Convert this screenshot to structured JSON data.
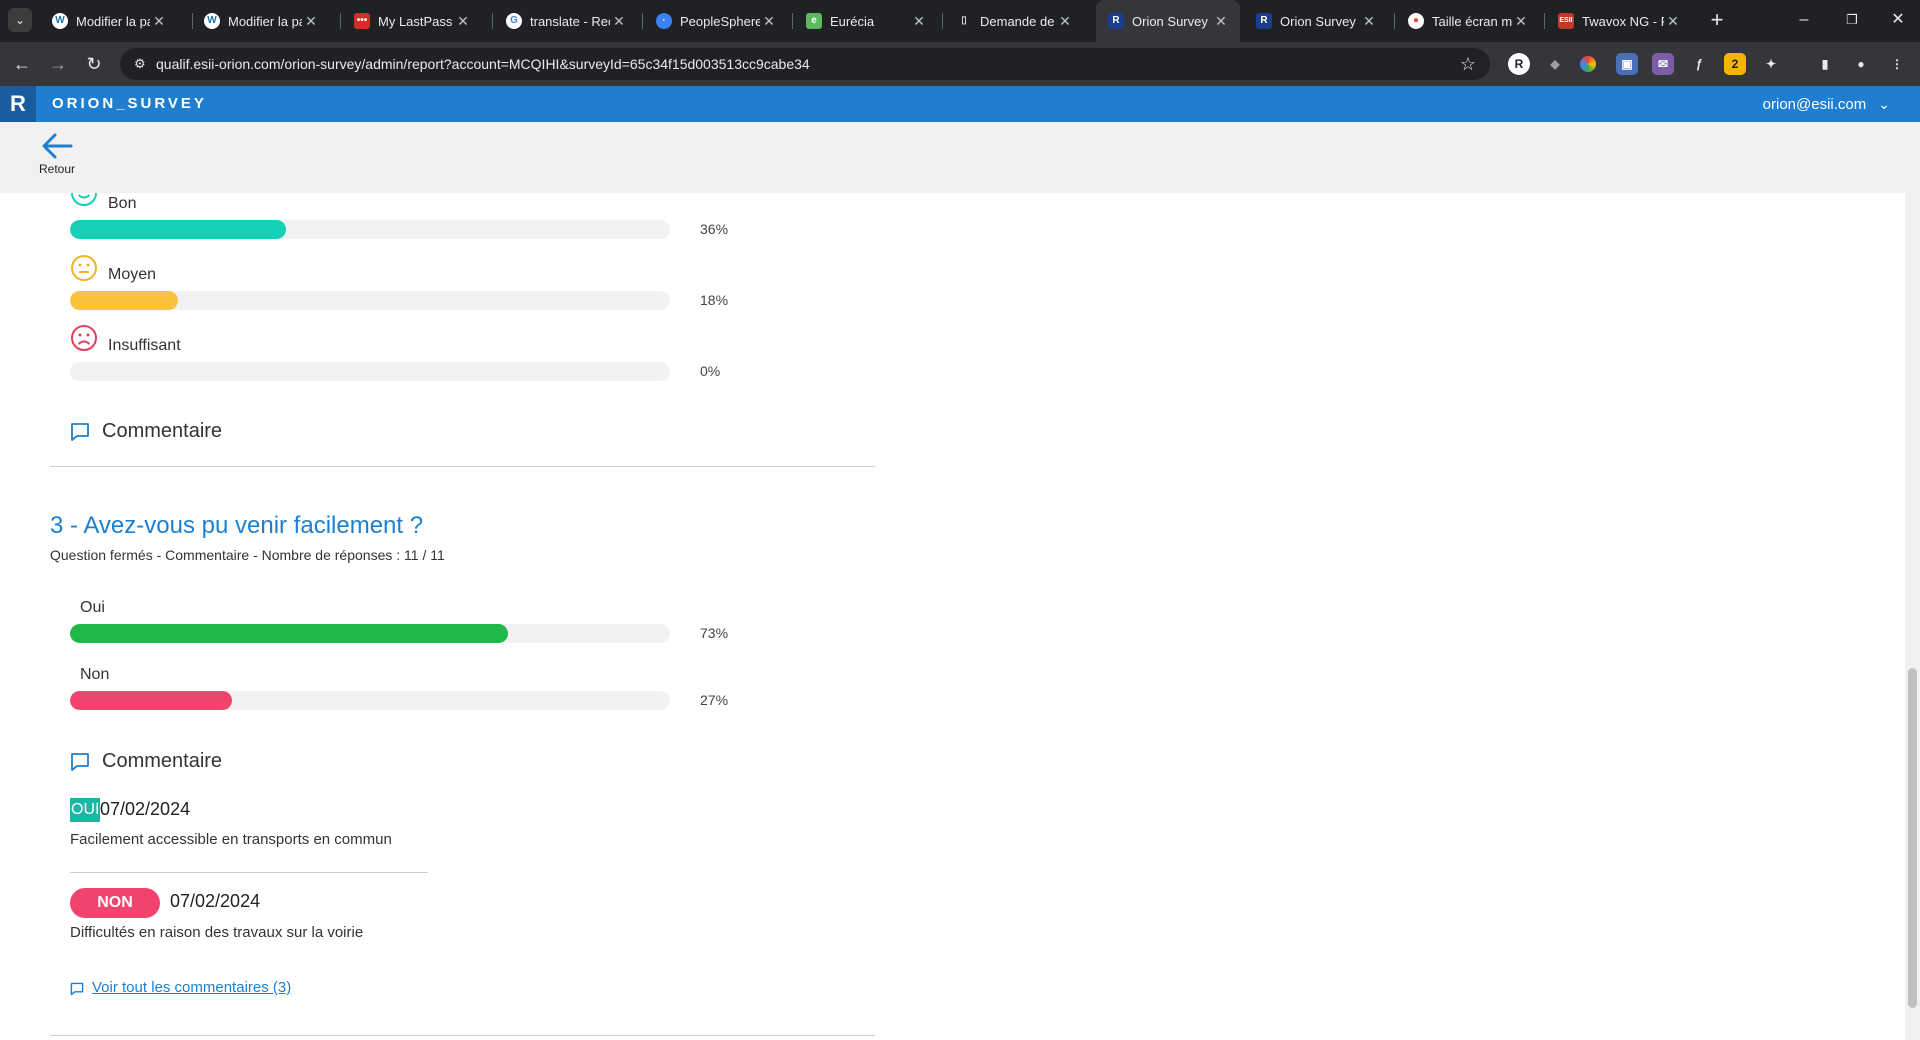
{
  "browser": {
    "tab_list_icon": "chevron-down-icon",
    "tabs": [
      {
        "title": "Modifier la page",
        "favicon": "wordpress-icon",
        "color": "#ffffff",
        "active": false
      },
      {
        "title": "Modifier la page",
        "favicon": "wordpress-icon",
        "color": "#ffffff",
        "active": false
      },
      {
        "title": "My LastPass Vault",
        "favicon": "lastpass-icon",
        "color": "#d32d27",
        "active": false
      },
      {
        "title": "translate - Recherche",
        "favicon": "google-icon",
        "color": "#ffffff",
        "active": false
      },
      {
        "title": "PeopleSpheres",
        "favicon": "peoplespheres-icon",
        "color": "#3b82f6",
        "active": false
      },
      {
        "title": "Eurécia",
        "favicon": "eurecia-icon",
        "color": "#5cb85c",
        "active": false
      },
      {
        "title": "Demande de congé",
        "favicon": "document-icon",
        "color": "#333333",
        "active": false
      },
      {
        "title": "Orion Survey",
        "favicon": "orion-icon",
        "color": "#1a3d8f",
        "active": true
      },
      {
        "title": "Orion Survey",
        "favicon": "orion-icon",
        "color": "#1a3d8f",
        "active": false
      },
      {
        "title": "Taille écran moyen",
        "favicon": "record-icon",
        "color": "#e74c3c",
        "active": false
      },
      {
        "title": "Twavox NG - Pa",
        "favicon": "esii-icon",
        "color": "#c0392b",
        "active": false
      }
    ],
    "url": "qualif.esii-orion.com/orion-survey/admin/report?account=MCQIHI&surveyId=65c34f15d003513cc9cabe34"
  },
  "app": {
    "logo": "R",
    "title": "ORION_SURVEY",
    "user": "orion@esii.com",
    "back_label": "Retour"
  },
  "question2": {
    "options": [
      {
        "label": "Bon",
        "percent": "36%",
        "value": 36,
        "color": "#15cfb7",
        "face": "happy-face-icon",
        "face_color": "#15cfb7"
      },
      {
        "label": "Moyen",
        "percent": "18%",
        "value": 18,
        "color": "#fbc33d",
        "face": "neutral-face-icon",
        "face_color": "#f0b429"
      },
      {
        "label": "Insuffisant",
        "percent": "0%",
        "value": 0,
        "color": "#f0436e",
        "face": "sad-face-icon",
        "face_color": "#e0405f"
      }
    ],
    "comment_heading": "Commentaire"
  },
  "question3": {
    "title": "3 - Avez-vous pu venir facilement ?",
    "meta": "Question fermés - Commentaire - Nombre de réponses : 11 / 11",
    "options": [
      {
        "label": "Oui",
        "percent": "73%",
        "value": 73,
        "color": "#1fb84a"
      },
      {
        "label": "Non",
        "percent": "27%",
        "value": 27,
        "color": "#f0436e"
      }
    ],
    "comment_heading": "Commentaire",
    "comments": [
      {
        "badge": "OUI",
        "date": "07/02/2024",
        "text": "Facilement accessible en transports en commun"
      },
      {
        "badge": "NON",
        "date": "07/02/2024",
        "text": "Difficultés en raison des travaux sur la voirie"
      }
    ],
    "see_all": "Voir tout les commentaires (3)"
  }
}
